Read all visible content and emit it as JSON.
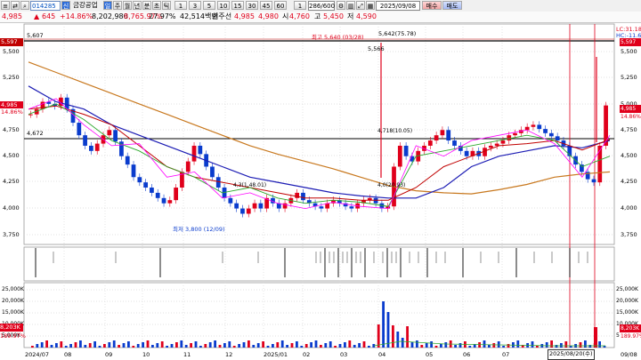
{
  "toolbar1": {
    "stock_code": "014285",
    "stock_name": "금강공업",
    "period_buttons": [
      "일",
      "주",
      "월",
      "년",
      "분",
      "초",
      "틱"
    ],
    "interval_buttons": [
      "1",
      "3",
      "5",
      "10",
      "15",
      "30",
      "45",
      "60"
    ],
    "unit_value": "1",
    "count_value": "286/600",
    "date_value": "2025/09/08",
    "buy_label": "매수",
    "sell_label": "매도"
  },
  "toolbar2": {
    "price": "4,985",
    "change": "645",
    "change_pct": "+14.86%",
    "volume": "8,202,980",
    "vol_ratio": "8,765.97%",
    "turnover": "27.97%",
    "amount": "42,514백만",
    "amount_label": "회주선",
    "p1": "4,985",
    "p2": "4,980",
    "open_label": "시",
    "open": "4,760",
    "high_label": "고",
    "high": "5,450",
    "low_label": "저",
    "low": "4,590"
  },
  "price_axis": {
    "ticks": [
      "5,500",
      "5,250",
      "5,000",
      "4,750",
      "4,500",
      "4,250",
      "4,000",
      "3,750"
    ],
    "tag_close": "4,985",
    "tag_pct": "14.86%",
    "tag_top": "5,597",
    "lc_label": "LC:31.18",
    "hc_label": "HC:-11.6"
  },
  "annotations": {
    "left_5607": "5,607",
    "left_4672": "4,672",
    "left_tag_top": "5,597",
    "left_tag_close": "4,985",
    "left_tag_pct": "14.86%",
    "high_note": "최고 5,640 (03/28)",
    "peak_note": "5,642(75.78)",
    "peak_low": "5,566",
    "low_note": "최저 3,800 (12/09)",
    "mid_note": "4,718(10.05)",
    "mid_low": "4,0(20.93)",
    "left_mid": "4,3(1,48.01)"
  },
  "volume_axis": {
    "ticks": [
      "25,000K",
      "20,000K",
      "15,000K",
      "10,000K",
      "5,000K"
    ],
    "tag_vol": "8,203K",
    "tag_pct": "189.97%"
  },
  "date_axis": {
    "labels": [
      "2024/07",
      "08",
      "09",
      "10",
      "11",
      "12",
      "2025/01",
      "02",
      "03",
      "04",
      "05",
      "06",
      "07",
      "09/08"
    ],
    "cursor_label": "2025/08/20(수)"
  },
  "colors": {
    "up": "#e0001b",
    "down": "#0a3ccd",
    "ma5": "#ff00ff",
    "ma20": "#2ea82e",
    "ma60": "#c00000",
    "ma120": "#1c1cb4",
    "ma240": "#c8781e"
  }
}
